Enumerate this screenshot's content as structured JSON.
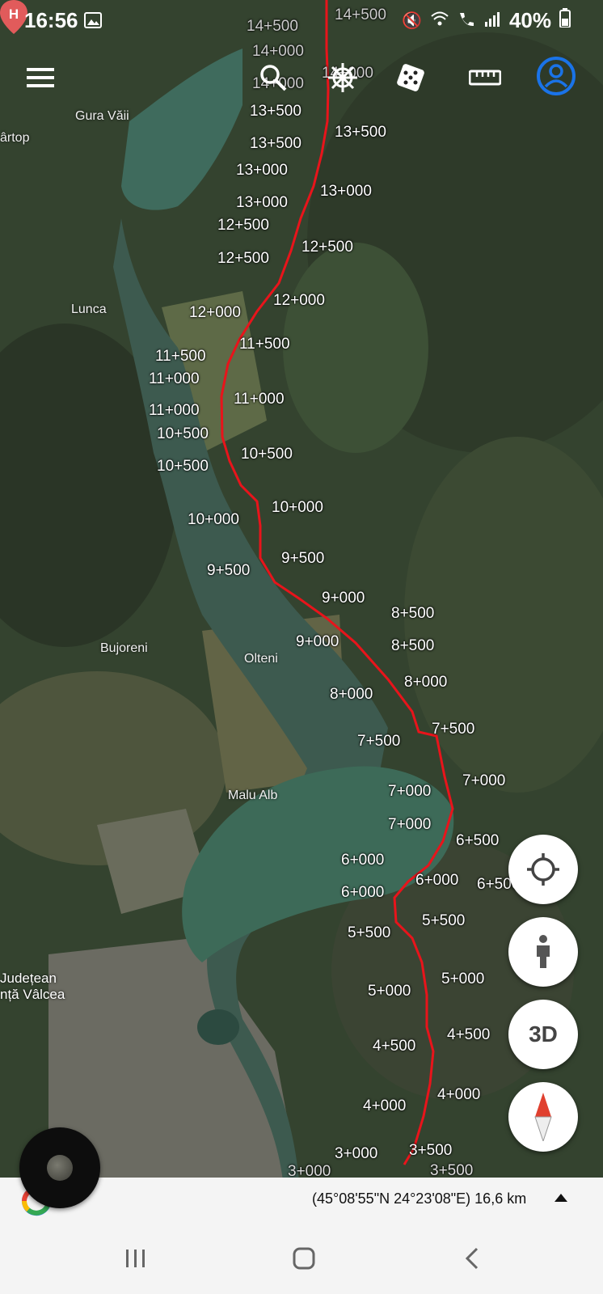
{
  "status_bar": {
    "time": "16:56",
    "battery": "40%"
  },
  "toolbar": {
    "icons": [
      "menu-icon",
      "search-icon",
      "ship-wheel-icon",
      "dice-icon",
      "ruler-icon",
      "account-icon"
    ]
  },
  "km_labels": [
    "14+500",
    "14+500",
    "14+000",
    "14+000",
    "14+000",
    "13+500",
    "13+500",
    "13+500",
    "13+000",
    "13+000",
    "13+000",
    "12+500",
    "12+500",
    "12+500",
    "12+000",
    "12+000",
    "11+500",
    "11+500",
    "11+000",
    "11+000",
    "11+000",
    "10+500",
    "10+500",
    "10+500",
    "10+000",
    "10+000",
    "9+500",
    "9+500",
    "9+000",
    "9+000",
    "8+500",
    "8+500",
    "8+000",
    "8+000",
    "7+500",
    "7+500",
    "7+000",
    "7+000",
    "7+000",
    "6+500",
    "6+500",
    "6+000",
    "6+000",
    "6+000",
    "5+500",
    "5+500",
    "5+000",
    "5+000",
    "4+500",
    "4+500",
    "4+000",
    "4+000",
    "3+500",
    "3+500",
    "3+000",
    "3+000"
  ],
  "places": [
    "Gura Văii",
    "ârtop",
    "Lunca",
    "Bujoreni",
    "Olteni",
    "Malu Alb"
  ],
  "hospital_label": {
    "line1": "Județean",
    "line2": "nță Vâlcea"
  },
  "controls": {
    "locate": "crosshair-icon",
    "street_view": "person-icon",
    "three_d": "3D",
    "compass": "compass-icon"
  },
  "bottom_bar": {
    "coordinates": "(45°08'55\"N 24°23'08\"E) 16,6 km"
  },
  "colors": {
    "route": "#e8141b",
    "fab_bg": "#ffffff",
    "account": "#1a73e8"
  }
}
